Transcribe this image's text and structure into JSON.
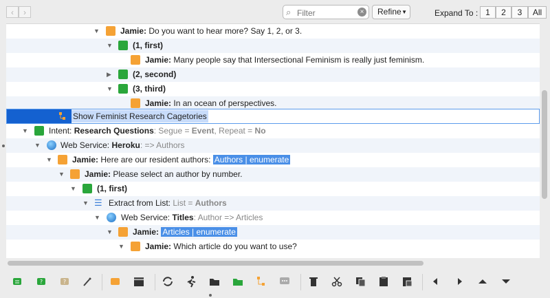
{
  "toolbar": {
    "back_label": "‹",
    "forward_label": "›",
    "filter_placeholder": "Filter",
    "filter_value": "",
    "refine_label": "Refine",
    "expand_label": "Expand To :",
    "expand_levels": [
      "1",
      "2",
      "3",
      "All"
    ]
  },
  "outline": {
    "rows": [
      {
        "speaker": "Jamie:",
        "text": " Do you want to hear more? Say 1, 2, or 3."
      },
      {
        "label": "(1, first)"
      },
      {
        "speaker": "Jamie:",
        "text": " Many people say that Intersectional Feminism is really just feminism."
      },
      {
        "label": "(2, second)"
      },
      {
        "label": "(3, third)"
      },
      {
        "speaker": "Jamie:",
        "text": " In an ocean of perspectives."
      },
      {
        "text": "Show Feminist Research Cagetories"
      },
      {
        "prefix": "Intent: ",
        "name": "Research Questions",
        "seg_label": ": Segue = ",
        "seg_value": "Event",
        "rep_label": ", Repeat = ",
        "rep_value": "No"
      },
      {
        "prefix": "Web Service: ",
        "name": "Heroku",
        "arrow": ": => Authors"
      },
      {
        "speaker": "Jamie:",
        "text": " Here are our resident authors: ",
        "highlight": "Authors | enumerate"
      },
      {
        "speaker": "Jamie:",
        "text": " Please select an author by number."
      },
      {
        "label": "(1, first)"
      },
      {
        "prefix": "Extract from List: ",
        "list_label": "List = ",
        "list_value": "Authors"
      },
      {
        "prefix": "Web Service: ",
        "name": "Titles",
        "arrow": ": Author => Articles"
      },
      {
        "speaker": "Jamie:",
        "text": " ",
        "highlight": "Articles | enumerate"
      },
      {
        "speaker": "Jamie:",
        "text": " Which article do you want to use?"
      }
    ]
  },
  "bottom_toolbar": {
    "icons": [
      "add-intent-icon",
      "add-response-icon",
      "add-disabled-icon",
      "magic-wand-icon",
      "add-speech-icon",
      "clapperboard-icon",
      "refresh-icon",
      "run-icon",
      "folder-icon",
      "folder-add-icon",
      "branch-icon",
      "comment-icon",
      "trash-icon",
      "cut-icon",
      "copy-icon",
      "paste-icon",
      "paste-special-icon",
      "move-left-icon",
      "move-right-icon",
      "move-up-icon",
      "move-down-icon"
    ]
  },
  "colors": {
    "selection": "#1461d0",
    "highlight": "#4a8fe7",
    "speech_icon": "#f5a235",
    "response_icon": "#2aa63b"
  }
}
